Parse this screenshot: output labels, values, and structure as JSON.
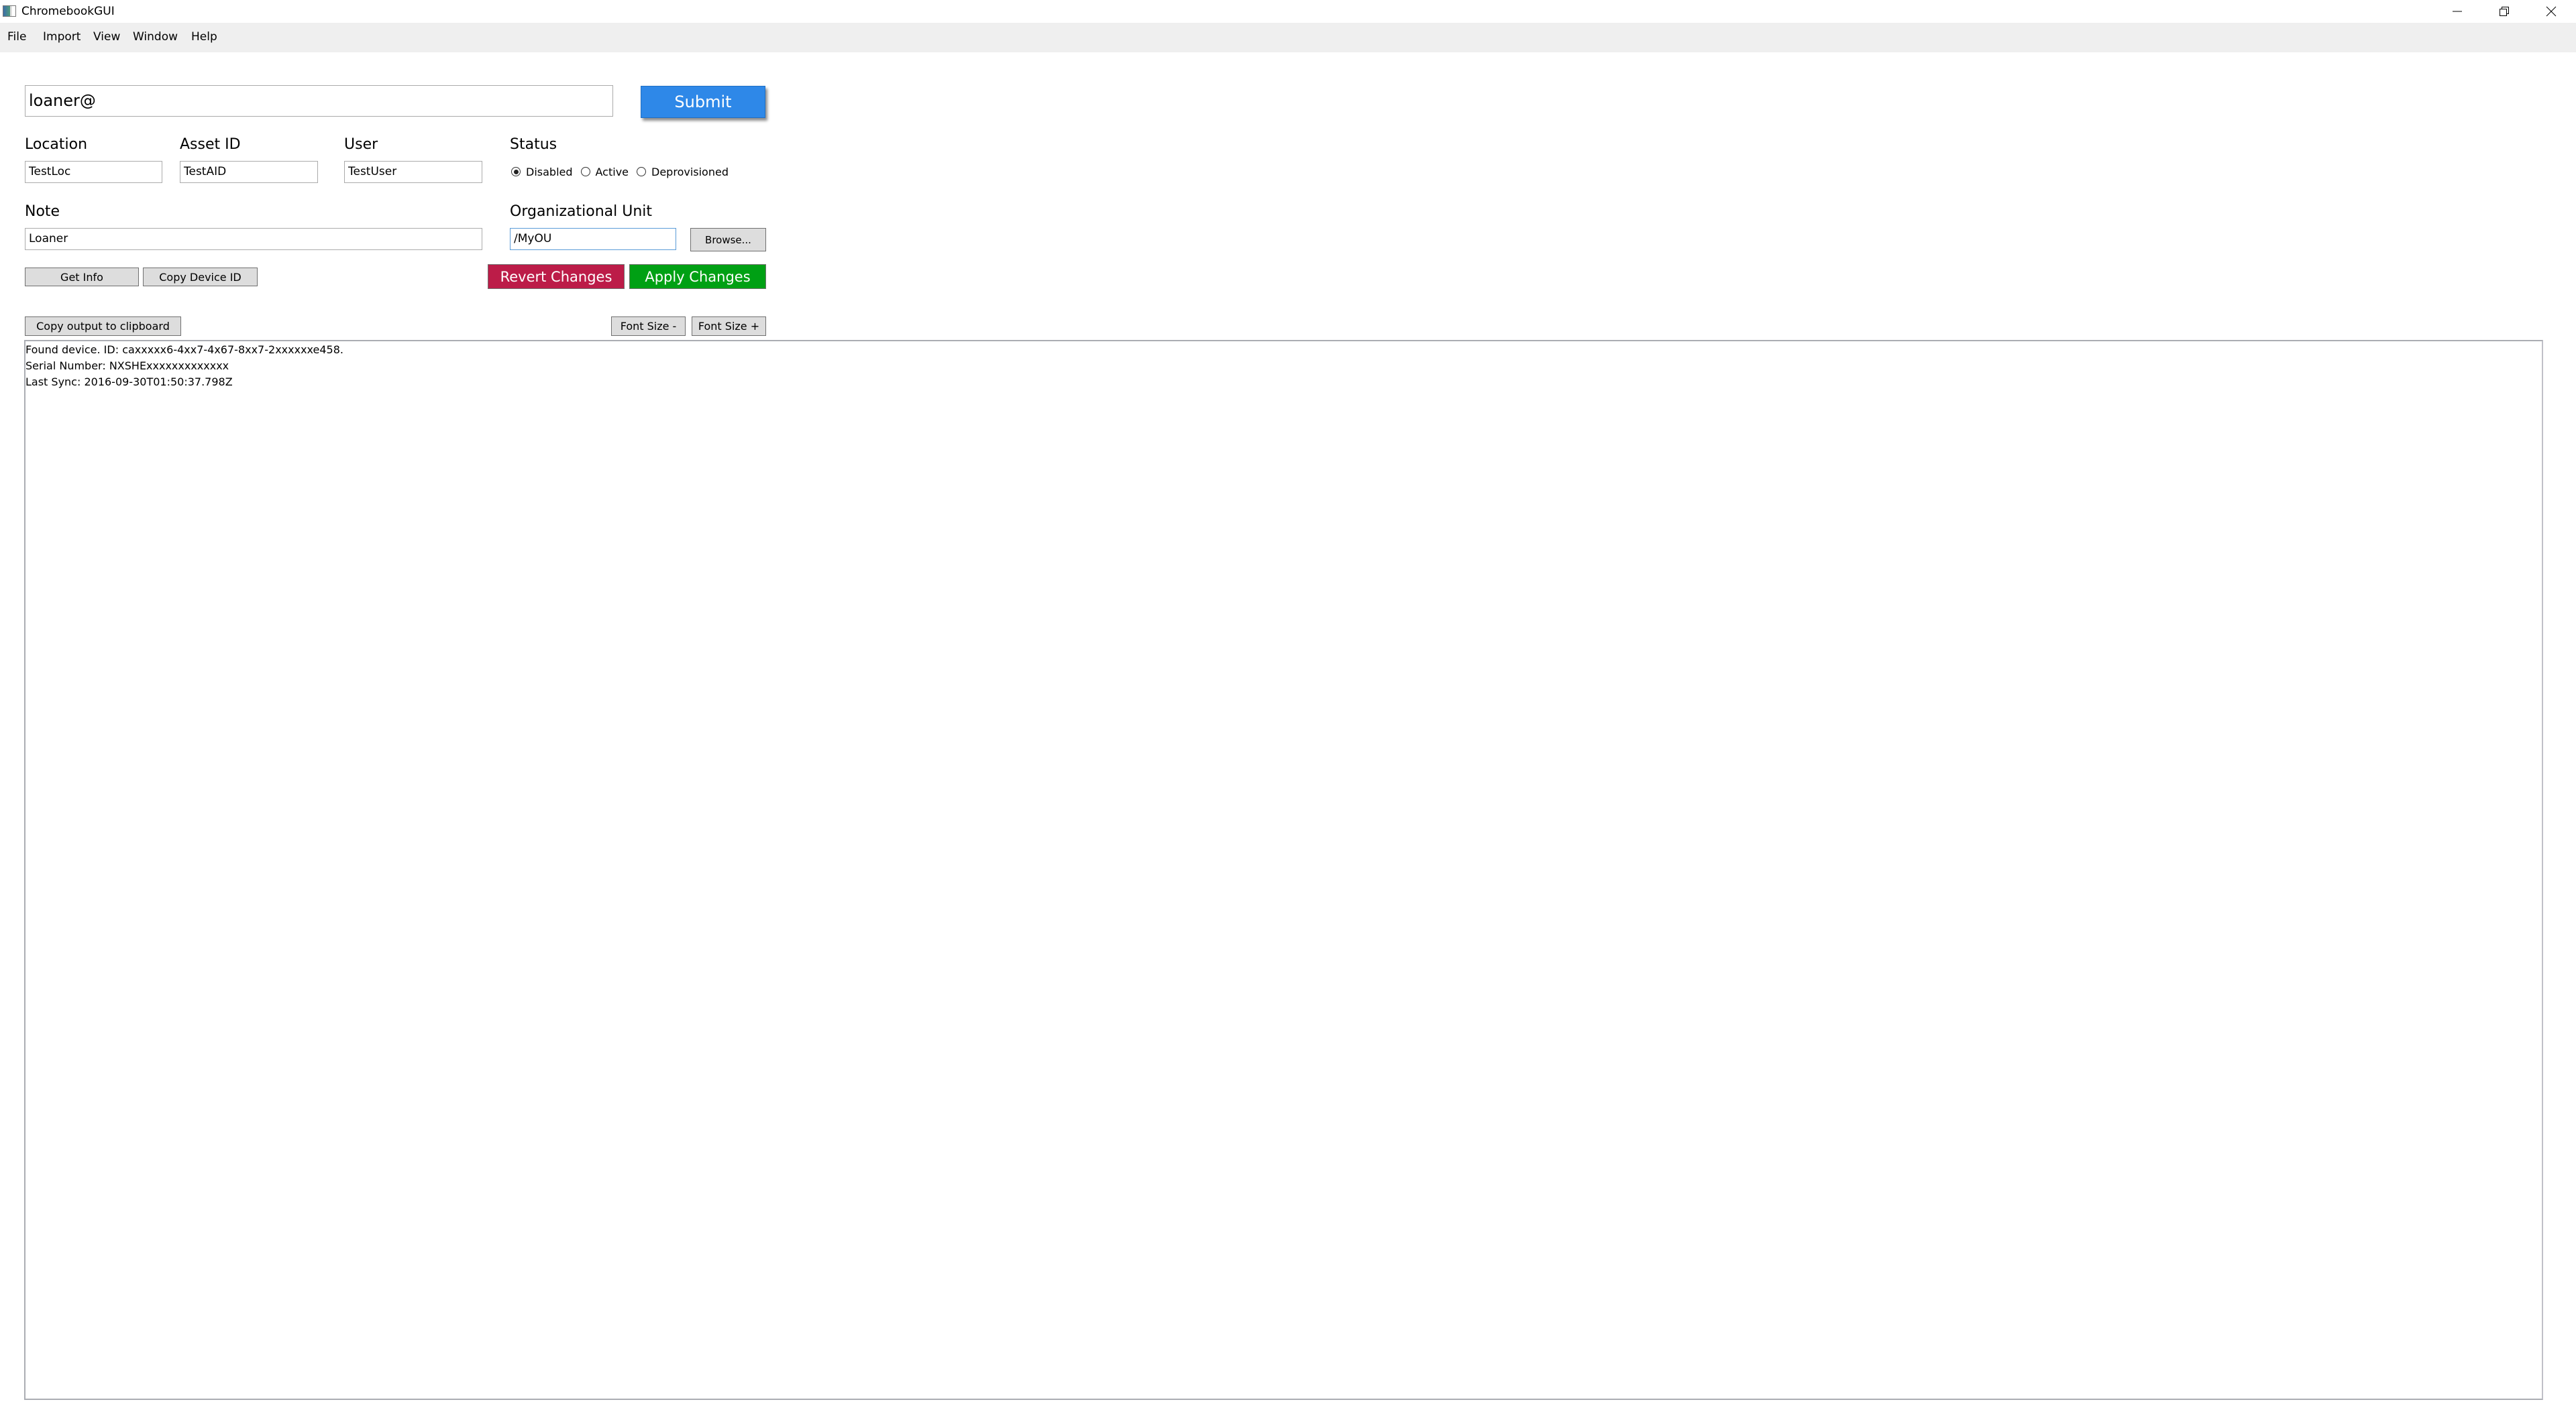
{
  "window": {
    "title": "ChromebookGUI",
    "icons": {
      "app": "app-window-icon",
      "minimize": "minimize-icon",
      "restore": "restore-icon",
      "close": "close-icon"
    }
  },
  "menu": [
    "File",
    "Import",
    "View",
    "Window",
    "Help"
  ],
  "search": {
    "value": "loaner@",
    "submit_label": "Submit",
    "submit_color": "#2e88e8"
  },
  "fields": {
    "location": {
      "label": "Location",
      "value": "TestLoc"
    },
    "asset_id": {
      "label": "Asset ID",
      "value": "TestAID"
    },
    "user": {
      "label": "User",
      "value": "TestUser"
    },
    "note": {
      "label": "Note",
      "value": "Loaner"
    },
    "org_unit": {
      "label": "Organizational Unit",
      "value": "/MyOU",
      "browse_label": "Browse..."
    }
  },
  "status": {
    "label": "Status",
    "options": [
      "Disabled",
      "Active",
      "Deprovisioned"
    ],
    "selected": "Disabled"
  },
  "actions": {
    "get_info": "Get Info",
    "copy_device_id": "Copy Device ID",
    "revert": "Revert Changes",
    "apply": "Apply Changes",
    "revert_color": "#bc1c48",
    "apply_color": "#00a014"
  },
  "output": {
    "copy_label": "Copy output to clipboard",
    "font_minus": "Font Size -",
    "font_plus": "Font Size +",
    "lines": [
      "Found device. ID: caxxxxx6-4xx7-4x67-8xx7-2xxxxxxe458.",
      "Serial Number: NXSHExxxxxxxxxxxxx",
      "Last Sync: 2016-09-30T01:50:37.798Z"
    ]
  }
}
